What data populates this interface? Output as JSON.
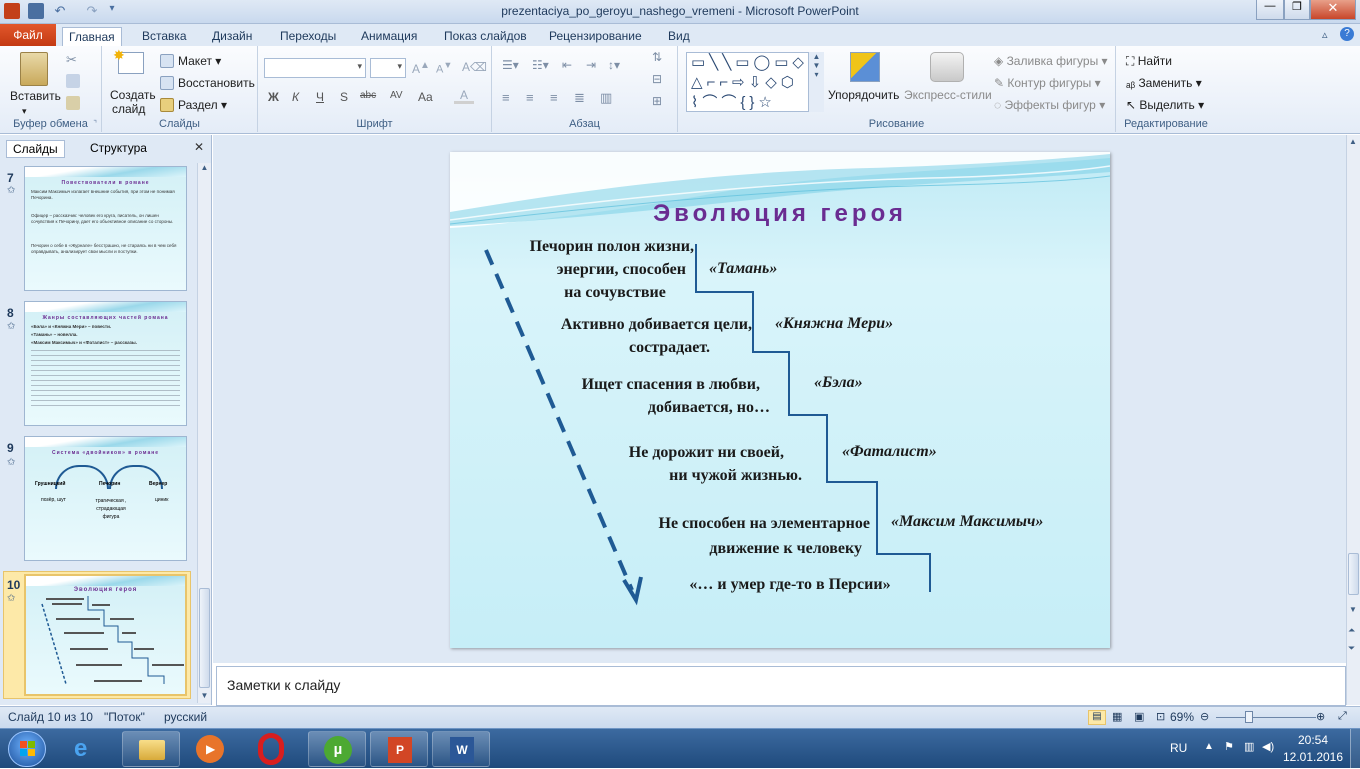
{
  "window": {
    "title": "prezentaciya_po_geroyu_nashego_vremeni - Microsoft PowerPoint"
  },
  "tabs": {
    "file": "Файл",
    "items": [
      "Главная",
      "Вставка",
      "Дизайн",
      "Переходы",
      "Анимация",
      "Показ слайдов",
      "Рецензирование",
      "Вид"
    ],
    "active": "Главная"
  },
  "ribbon": {
    "clipboard": {
      "paste": "Вставить",
      "label": "Буфер обмена"
    },
    "slides": {
      "create": "Создать",
      "create2": "слайд",
      "layout": "Макет",
      "reset": "Восстановить",
      "section": "Раздел",
      "label": "Слайды"
    },
    "font": {
      "label": "Шрифт",
      "font_name": "",
      "font_size": "",
      "buttons": [
        "Ж",
        "К",
        "Ч",
        "S",
        "abc",
        "AV",
        "Aa"
      ]
    },
    "paragraph": {
      "label": "Абзац"
    },
    "drawing": {
      "arrange": "Упорядочить",
      "quickstyles": "Экспресс-стили",
      "fill": "Заливка фигуры",
      "outline": "Контур фигуры",
      "effects": "Эффекты фигур",
      "label": "Рисование"
    },
    "editing": {
      "find": "Найти",
      "replace": "Заменить",
      "select": "Выделить",
      "label": "Редактирование"
    }
  },
  "panes": {
    "slides_tab": "Слайды",
    "outline_tab": "Структура"
  },
  "thumbnails": [
    {
      "num": "7",
      "title": "Повествователи в романе",
      "lines": [
        "Максим Максимыч излагает внешние события, при этом не понимая Печорина.",
        "Офицер – рассказчик: человек его круга, писатель, он лишен сочувствия к Печорину, дает его объективное описание со стороны.",
        "Печорин о себе в «Журнале» бесстрашно, не стараясь ни в чем себя оправдывать, анализирует свои мысли и поступки."
      ]
    },
    {
      "num": "8",
      "title": "Жанры составляющих частей романа",
      "lines": [
        "«Бэла» и «Княжна Мери» – повести.",
        "«Тамань» – новелла.",
        "«Максим Максимыч» и «Фаталист» – рассказы."
      ]
    },
    {
      "num": "9",
      "title": "Система «двойников» в романе",
      "nodes": [
        "Грушницкий",
        "Печорин",
        "Вернер"
      ],
      "subs": [
        "позёр, шут",
        "трагическая , страдающая фигура",
        "циник"
      ]
    },
    {
      "num": "10",
      "title": "Эволюция героя"
    }
  ],
  "slide": {
    "title": "Эволюция героя",
    "steps": [
      {
        "text1": "Печорин полон жизни,",
        "text2": "энергии, способен",
        "text3": "на сочувствие",
        "story": "«Тамань»"
      },
      {
        "text1": "Активно добивается цели,",
        "text2": "сострадает.",
        "story": "«Княжна Мери»"
      },
      {
        "text1": "Ищет спасения в любви,",
        "text2": "добивается, но…",
        "story": "«Бэла»"
      },
      {
        "text1": "Не дорожит ни своей,",
        "text2": "ни чужой жизнью.",
        "story": "«Фаталист»"
      },
      {
        "text1": "Не способен  на элементарное",
        "text2": "движение  к человеку",
        "story": "«Максим Максимыч»"
      }
    ],
    "ending": "«… и умер где-то в Персии»"
  },
  "notes": {
    "placeholder": "Заметки к слайду"
  },
  "status": {
    "slide": "Слайд 10 из 10",
    "theme": "\"Поток\"",
    "lang": "русский",
    "zoom": "69%"
  },
  "taskbar": {
    "lang": "RU",
    "time": "20:54",
    "date": "12.01.2016"
  }
}
